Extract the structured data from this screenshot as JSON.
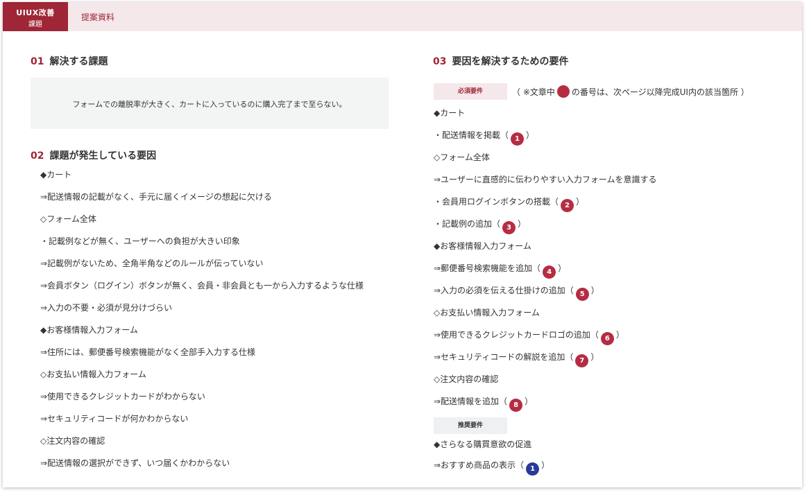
{
  "header": {
    "logo_main": "UIUX改善",
    "logo_sub": "課題",
    "title": "提案資料"
  },
  "sections": {
    "s01": {
      "num": "01",
      "title": "解決する課題",
      "issue_text": "フォームでの離脱率が大きく、カートに入っているのに購入完了まで至らない。"
    },
    "s02": {
      "num": "02",
      "title": "課題が発生している要因",
      "lines": [
        "◆カート",
        "⇒配送情報の記載がなく、手元に届くイメージの想起に欠ける",
        "◇フォーム全体",
        "・記載例などが無く、ユーザーへの負担が大きい印象",
        "⇒記載例がないため、全角半角などのルールが伝っていない",
        "⇒会員ボタン（ログイン）ボタンが無く、会員・非会員とも一から入力するような仕様",
        "⇒入力の不要・必須が見分けづらい",
        "◆お客様情報入力フォーム",
        "⇒住所には、郵便番号検索機能がなく全部手入力する仕様",
        "◇お支払い情報入力フォーム",
        "⇒使用できるクレジットカードがわからない",
        "⇒セキュリティコードが何かわからない",
        "◇注文内容の確認",
        "⇒配送情報の選択ができず、いつ届くかわからない"
      ]
    },
    "s03": {
      "num": "03",
      "title": "要因を解決するための要件",
      "required_tag": "必須要件",
      "note_before": "（ ※文章中",
      "note_after": "の番号は、次ページ以降完成UI内の該当箇所 ）",
      "recommended_tag": "推奨要件",
      "lines": [
        {
          "text": "◆カート"
        },
        {
          "text": "・配送情報を掲載（",
          "badge": "1",
          "tail": "）"
        },
        {
          "text": "◇フォーム全体"
        },
        {
          "text": "⇒ユーザーに直感的に伝わりやすい入力フォームを意識する"
        },
        {
          "text": "・会員用ログインボタンの搭載（",
          "badge": "2",
          "tail": "）"
        },
        {
          "text": "・記載例の追加（",
          "badge": "3",
          "tail": "）"
        },
        {
          "text": "◆お客様情報入力フォーム"
        },
        {
          "text": "⇒郵便番号検索機能を追加（",
          "badge": "4",
          "tail": "）"
        },
        {
          "text": "⇒入力の必須を伝える仕掛けの追加（",
          "badge": "5",
          "tail": "）"
        },
        {
          "text": "◇お支払い情報入力フォーム"
        },
        {
          "text": "⇒使用できるクレジットカードロゴの追加（",
          "badge": "6",
          "tail": "）"
        },
        {
          "text": "⇒セキュリティコードの解説を追加（",
          "badge": "7",
          "tail": "）"
        },
        {
          "text": "◇注文内容の確認"
        },
        {
          "text": "⇒配送情報を追加（",
          "badge": "8",
          "tail": "）"
        }
      ],
      "recommended_lines": [
        {
          "text": "◆さらなる購買意欲の促進"
        },
        {
          "text": "⇒おすすめ商品の表示（",
          "badge": "1",
          "tail": "）"
        }
      ]
    }
  },
  "colors": {
    "accent": "#9e2636",
    "badge_red": "#b52d42",
    "badge_blue": "#2a3a9a"
  }
}
